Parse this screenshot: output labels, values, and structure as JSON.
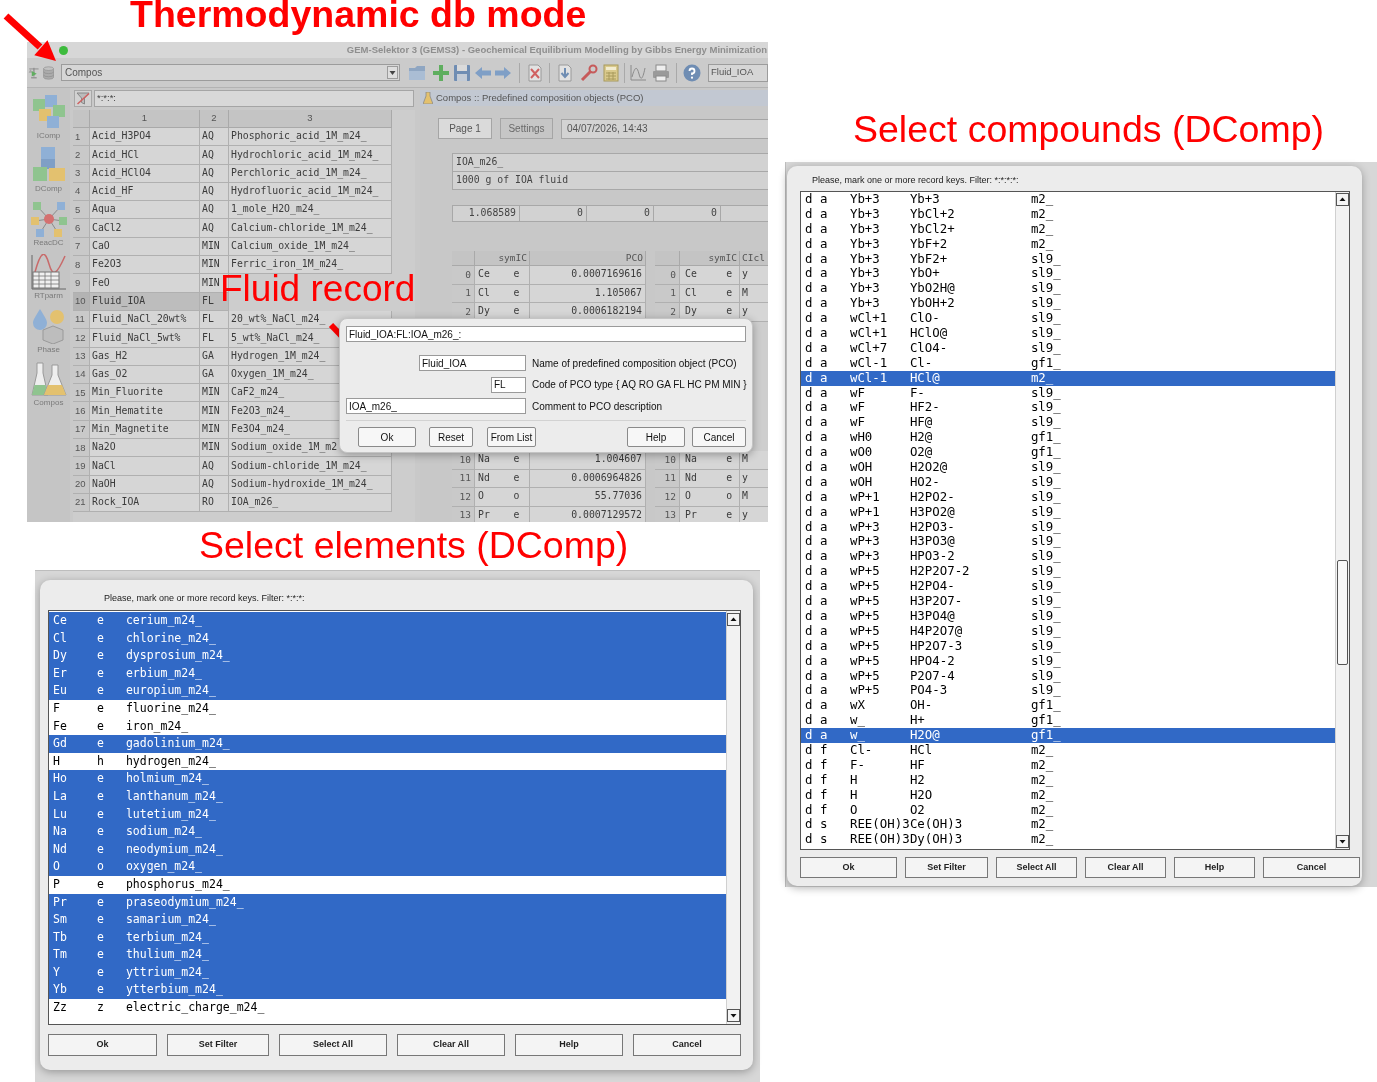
{
  "heading": "Thermodynamic db mode",
  "main_window": {
    "title": "GEM-Selektor 3 (GEMS3) - Geochemical Equilibrium Modelling by Gibbs Energy Minimization",
    "module": "Compos",
    "record_key": "Fluid_IOA",
    "sidebar": [
      "IComp",
      "DComp",
      "ReacDC",
      "RTparm",
      "Phase",
      "Compos"
    ],
    "filter": "*:*:*:",
    "records": {
      "columns": [
        "1",
        "2",
        "3"
      ],
      "rows": [
        {
          "number": "1",
          "cells": [
            "Acid_H3PO4",
            "AQ",
            "Phosphoric_acid_1M_m24_"
          ],
          "selected": false
        },
        {
          "number": "2",
          "cells": [
            "Acid_HCl",
            "AQ",
            "Hydrochloric_acid_1M_m24_"
          ],
          "selected": false
        },
        {
          "number": "3",
          "cells": [
            "Acid_HClO4",
            "AQ",
            "Perchloric_acid_1M_m24_"
          ],
          "selected": false
        },
        {
          "number": "4",
          "cells": [
            "Acid_HF",
            "AQ",
            "Hydrofluoric_acid_1M_m24_"
          ],
          "selected": false
        },
        {
          "number": "5",
          "cells": [
            "Aqua",
            "AQ",
            "1_mole_H2O_m24_"
          ],
          "selected": false
        },
        {
          "number": "6",
          "cells": [
            "CaCl2",
            "AQ",
            "Calcium-chloride_1M_m24_"
          ],
          "selected": false
        },
        {
          "number": "7",
          "cells": [
            "CaO",
            "MIN",
            "Calcium_oxide_1M_m24_"
          ],
          "selected": false
        },
        {
          "number": "8",
          "cells": [
            "Fe2O3",
            "MIN",
            "Ferric_iron_1M_m24_"
          ],
          "selected": false
        },
        {
          "number": "9",
          "cells": [
            "FeO",
            "MIN"
          ],
          "selected": false
        },
        {
          "number": "10",
          "cells": [
            "Fluid_IOA",
            "FL"
          ],
          "selected": true
        },
        {
          "number": "11",
          "cells": [
            "Fluid_NaCl_20wt%",
            "FL",
            "20_wt%_NaCl_m24_"
          ],
          "selected": false
        },
        {
          "number": "12",
          "cells": [
            "Fluid_NaCl_5wt%",
            "FL",
            "5_wt%_NaCl_m24_"
          ],
          "selected": false
        },
        {
          "number": "13",
          "cells": [
            "Gas_H2",
            "GA",
            "Hydrogen_1M_m24_"
          ],
          "selected": false
        },
        {
          "number": "14",
          "cells": [
            "Gas_O2",
            "GA",
            "Oxygen_1M_m24_"
          ],
          "selected": false
        },
        {
          "number": "15",
          "cells": [
            "Min_Fluorite",
            "MIN",
            "CaF2_m24_"
          ],
          "selected": false
        },
        {
          "number": "16",
          "cells": [
            "Min_Hematite",
            "MIN",
            "Fe2O3_m24_"
          ],
          "selected": false
        },
        {
          "number": "17",
          "cells": [
            "Min_Magnetite",
            "MIN",
            "Fe3O4_m24_"
          ],
          "selected": false
        },
        {
          "number": "18",
          "cells": [
            "Na2O",
            "MIN",
            "Sodium_oxide_1M_m2"
          ],
          "selected": false
        },
        {
          "number": "19",
          "cells": [
            "NaCl",
            "AQ",
            "Sodium-chloride_1M_m24_"
          ],
          "selected": false
        },
        {
          "number": "20",
          "cells": [
            "NaOH",
            "AQ",
            "Sodium-hydroxide_1M_m24_"
          ],
          "selected": false
        },
        {
          "number": "21",
          "cells": [
            "Rock_IOA",
            "RO",
            "IOA_m26_"
          ],
          "selected": false
        }
      ]
    },
    "panel": {
      "header": "Compos :: Predefined composition objects (PCO)",
      "tabs": [
        {
          "label": "Page 1",
          "selected": true
        },
        {
          "label": "Settings",
          "selected": false
        }
      ],
      "timestamp": "04/07/2026, 14:43",
      "description": [
        "IOA_m26_",
        "1000 g of IOA fluid"
      ],
      "values": [
        "1.068589",
        "0",
        "0",
        "0"
      ],
      "composition_table": {
        "columns": [
          "symIC",
          "PCO"
        ],
        "rows": [
          {
            "index": "0",
            "cells": [
              "Ce    e",
              "0.0007169616"
            ]
          },
          {
            "index": "1",
            "cells": [
              "Cl    e",
              "1.105067"
            ]
          },
          {
            "index": "2",
            "cells": [
              "Dy    e",
              "0.0006182194"
            ]
          },
          {
            "index": "10",
            "cells": [
              "Na    e",
              "1.004607"
            ]
          },
          {
            "index": "11",
            "cells": [
              "Nd    e",
              "0.0006964826"
            ]
          },
          {
            "index": "12",
            "cells": [
              "O     o",
              "55.77036"
            ]
          },
          {
            "index": "13",
            "cells": [
              "Pr    e",
              "0.0007129572"
            ]
          }
        ]
      },
      "units_table": {
        "columns": [
          "symIC",
          "CIcl"
        ],
        "rows": [
          {
            "index": "0",
            "cells": [
              "Ce     e",
              "y"
            ]
          },
          {
            "index": "1",
            "cells": [
              "Cl     e",
              "M"
            ]
          },
          {
            "index": "2",
            "cells": [
              "Dy     e",
              "y"
            ]
          },
          {
            "index": "10",
            "cells": [
              "Na     e",
              "M"
            ]
          },
          {
            "index": "11",
            "cells": [
              "Nd     e",
              "y"
            ]
          },
          {
            "index": "12",
            "cells": [
              "O      o",
              "M"
            ]
          },
          {
            "index": "13",
            "cells": [
              "Pr     e",
              "y"
            ]
          }
        ]
      }
    }
  },
  "fluid_record_label": "Fluid record",
  "fluid_record_dialog": {
    "record_key": "Fluid_IOA:FL:IOA_m26_:",
    "fields": [
      {
        "value": "Fluid_IOA",
        "label": "Name of predefined composition object (PCO)"
      },
      {
        "value": "FL",
        "label": "Code of PCO type { AQ RO GA FL HC PM MIN }"
      },
      {
        "value": "IOA_m26_",
        "label": "Comment to PCO description"
      }
    ],
    "buttons_left": [
      "Ok",
      "Reset",
      "From List"
    ],
    "buttons_right": [
      "Help",
      "Cancel"
    ]
  },
  "select_compounds_label": "Select compounds (DComp)",
  "select_compounds_dialog": {
    "prompt": "Please, mark one or more record keys. Filter: *:*:*:*:",
    "rows": [
      {
        "cells": [
          "d",
          "a",
          "Yb+3",
          "Yb+3",
          "m2_"
        ],
        "selected": false
      },
      {
        "cells": [
          "d",
          "a",
          "Yb+3",
          "YbCl+2",
          "m2_"
        ],
        "selected": false
      },
      {
        "cells": [
          "d",
          "a",
          "Yb+3",
          "YbCl2+",
          "m2_"
        ],
        "selected": false
      },
      {
        "cells": [
          "d",
          "a",
          "Yb+3",
          "YbF+2",
          "m2_"
        ],
        "selected": false
      },
      {
        "cells": [
          "d",
          "a",
          "Yb+3",
          "YbF2+",
          "sl9_"
        ],
        "selected": false
      },
      {
        "cells": [
          "d",
          "a",
          "Yb+3",
          "YbO+",
          "sl9_"
        ],
        "selected": false
      },
      {
        "cells": [
          "d",
          "a",
          "Yb+3",
          "YbO2H@",
          "sl9_"
        ],
        "selected": false
      },
      {
        "cells": [
          "d",
          "a",
          "Yb+3",
          "YbOH+2",
          "sl9_"
        ],
        "selected": false
      },
      {
        "cells": [
          "d",
          "a",
          "wCl+1",
          "ClO-",
          "sl9_"
        ],
        "selected": false
      },
      {
        "cells": [
          "d",
          "a",
          "wCl+1",
          "HClO@",
          "sl9_"
        ],
        "selected": false
      },
      {
        "cells": [
          "d",
          "a",
          "wCl+7",
          "ClO4-",
          "sl9_"
        ],
        "selected": false
      },
      {
        "cells": [
          "d",
          "a",
          "wCl-1",
          "Cl-",
          "gf1_"
        ],
        "selected": false
      },
      {
        "cells": [
          "d",
          "a",
          "wCl-1",
          "HCl@",
          "m2_"
        ],
        "selected": true
      },
      {
        "cells": [
          "d",
          "a",
          "wF",
          "F-",
          "sl9_"
        ],
        "selected": false
      },
      {
        "cells": [
          "d",
          "a",
          "wF",
          "HF2-",
          "sl9_"
        ],
        "selected": false
      },
      {
        "cells": [
          "d",
          "a",
          "wF",
          "HF@",
          "sl9_"
        ],
        "selected": false
      },
      {
        "cells": [
          "d",
          "a",
          "wH0",
          "H2@",
          "gf1_"
        ],
        "selected": false
      },
      {
        "cells": [
          "d",
          "a",
          "wO0",
          "O2@",
          "gf1_"
        ],
        "selected": false
      },
      {
        "cells": [
          "d",
          "a",
          "wOH",
          "H2O2@",
          "sl9_"
        ],
        "selected": false
      },
      {
        "cells": [
          "d",
          "a",
          "wOH",
          "HO2-",
          "sl9_"
        ],
        "selected": false
      },
      {
        "cells": [
          "d",
          "a",
          "wP+1",
          "H2PO2-",
          "sl9_"
        ],
        "selected": false
      },
      {
        "cells": [
          "d",
          "a",
          "wP+1",
          "H3PO2@",
          "sl9_"
        ],
        "selected": false
      },
      {
        "cells": [
          "d",
          "a",
          "wP+3",
          "H2PO3-",
          "sl9_"
        ],
        "selected": false
      },
      {
        "cells": [
          "d",
          "a",
          "wP+3",
          "H3PO3@",
          "sl9_"
        ],
        "selected": false
      },
      {
        "cells": [
          "d",
          "a",
          "wP+3",
          "HPO3-2",
          "sl9_"
        ],
        "selected": false
      },
      {
        "cells": [
          "d",
          "a",
          "wP+5",
          "H2P2O7-2",
          "sl9_"
        ],
        "selected": false
      },
      {
        "cells": [
          "d",
          "a",
          "wP+5",
          "H2PO4-",
          "sl9_"
        ],
        "selected": false
      },
      {
        "cells": [
          "d",
          "a",
          "wP+5",
          "H3P2O7-",
          "sl9_"
        ],
        "selected": false
      },
      {
        "cells": [
          "d",
          "a",
          "wP+5",
          "H3PO4@",
          "sl9_"
        ],
        "selected": false
      },
      {
        "cells": [
          "d",
          "a",
          "wP+5",
          "H4P2O7@",
          "sl9_"
        ],
        "selected": false
      },
      {
        "cells": [
          "d",
          "a",
          "wP+5",
          "HP2O7-3",
          "sl9_"
        ],
        "selected": false
      },
      {
        "cells": [
          "d",
          "a",
          "wP+5",
          "HPO4-2",
          "sl9_"
        ],
        "selected": false
      },
      {
        "cells": [
          "d",
          "a",
          "wP+5",
          "P2O7-4",
          "sl9_"
        ],
        "selected": false
      },
      {
        "cells": [
          "d",
          "a",
          "wP+5",
          "PO4-3",
          "sl9_"
        ],
        "selected": false
      },
      {
        "cells": [
          "d",
          "a",
          "wX",
          "OH-",
          "gf1_"
        ],
        "selected": false
      },
      {
        "cells": [
          "d",
          "a",
          "w_",
          "H+",
          "gf1_"
        ],
        "selected": false
      },
      {
        "cells": [
          "d",
          "a",
          "w_",
          "H2O@",
          "gf1_"
        ],
        "selected": true
      },
      {
        "cells": [
          "d",
          "f",
          "Cl-",
          "HCl",
          "m2_"
        ],
        "selected": false
      },
      {
        "cells": [
          "d",
          "f",
          "F-",
          "HF",
          "m2_"
        ],
        "selected": false
      },
      {
        "cells": [
          "d",
          "f",
          "H",
          "H2",
          "m2_"
        ],
        "selected": false
      },
      {
        "cells": [
          "d",
          "f",
          "H",
          "H2O",
          "m2_"
        ],
        "selected": false
      },
      {
        "cells": [
          "d",
          "f",
          "O",
          "O2",
          "m2_"
        ],
        "selected": false
      },
      {
        "cells": [
          "d",
          "s",
          "REE(OH)3",
          "Ce(OH)3",
          "m2_"
        ],
        "selected": false
      },
      {
        "cells": [
          "d",
          "s",
          "REE(OH)3",
          "Dy(OH)3",
          "m2_"
        ],
        "selected": false
      }
    ],
    "buttons": [
      "Ok",
      "Set Filter",
      "Select All",
      "Clear All",
      "Help",
      "Cancel"
    ]
  },
  "select_elements_label": "Select elements (DComp)",
  "select_elements_dialog": {
    "prompt": "Please, mark one or more record keys. Filter: *:*:*:",
    "rows": [
      {
        "cells": [
          "Ce",
          "e",
          "cerium_m24_"
        ],
        "selected": true
      },
      {
        "cells": [
          "Cl",
          "e",
          "chlorine_m24_"
        ],
        "selected": true
      },
      {
        "cells": [
          "Dy",
          "e",
          "dysprosium_m24_"
        ],
        "selected": true
      },
      {
        "cells": [
          "Er",
          "e",
          "erbium_m24_"
        ],
        "selected": true
      },
      {
        "cells": [
          "Eu",
          "e",
          "europium_m24_"
        ],
        "selected": true
      },
      {
        "cells": [
          "F",
          "e",
          "fluorine_m24_"
        ],
        "selected": false
      },
      {
        "cells": [
          "Fe",
          "e",
          "iron_m24_"
        ],
        "selected": false
      },
      {
        "cells": [
          "Gd",
          "e",
          "gadolinium_m24_"
        ],
        "selected": true
      },
      {
        "cells": [
          "H",
          "h",
          "hydrogen_m24_"
        ],
        "selected": false
      },
      {
        "cells": [
          "Ho",
          "e",
          "holmium_m24_"
        ],
        "selected": true
      },
      {
        "cells": [
          "La",
          "e",
          "lanthanum_m24_"
        ],
        "selected": true
      },
      {
        "cells": [
          "Lu",
          "e",
          "lutetium_m24_"
        ],
        "selected": true
      },
      {
        "cells": [
          "Na",
          "e",
          "sodium_m24_"
        ],
        "selected": true
      },
      {
        "cells": [
          "Nd",
          "e",
          "neodymium_m24_"
        ],
        "selected": true
      },
      {
        "cells": [
          "O",
          "o",
          "oxygen_m24_"
        ],
        "selected": true
      },
      {
        "cells": [
          "P",
          "e",
          "phosphorus_m24_"
        ],
        "selected": false
      },
      {
        "cells": [
          "Pr",
          "e",
          "praseodymium_m24_"
        ],
        "selected": true
      },
      {
        "cells": [
          "Sm",
          "e",
          "samarium_m24_"
        ],
        "selected": true
      },
      {
        "cells": [
          "Tb",
          "e",
          "terbium_m24_"
        ],
        "selected": true
      },
      {
        "cells": [
          "Tm",
          "e",
          "thulium_m24_"
        ],
        "selected": true
      },
      {
        "cells": [
          "Y",
          "e",
          "yttrium_m24_"
        ],
        "selected": true
      },
      {
        "cells": [
          "Yb",
          "e",
          "ytterbium_m24_"
        ],
        "selected": true
      },
      {
        "cells": [
          "Zz",
          "z",
          "electric_charge_m24_"
        ],
        "selected": false
      }
    ],
    "buttons": [
      "Ok",
      "Set Filter",
      "Select All",
      "Clear All",
      "Help",
      "Cancel"
    ]
  }
}
